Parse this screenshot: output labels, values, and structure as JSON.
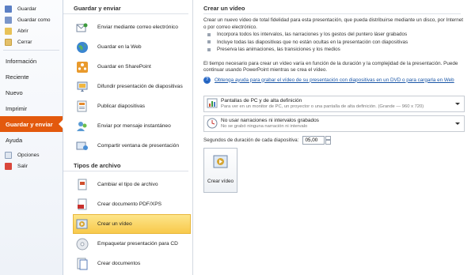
{
  "nav": {
    "top_items": [
      {
        "label": "Guardar",
        "icon": "save-icon"
      },
      {
        "label": "Guardar como",
        "icon": "save-as-icon"
      },
      {
        "label": "Abrir",
        "icon": "open-folder-icon"
      },
      {
        "label": "Cerrar",
        "icon": "close-file-icon"
      }
    ],
    "main_items": [
      {
        "label": "Información"
      },
      {
        "label": "Reciente"
      },
      {
        "label": "Nuevo"
      },
      {
        "label": "Imprimir"
      },
      {
        "label": "Guardar y enviar",
        "active": true
      },
      {
        "label": "Ayuda"
      }
    ],
    "bottom_items": [
      {
        "label": "Opciones",
        "icon": "options-icon"
      },
      {
        "label": "Salir",
        "icon": "exit-icon"
      }
    ]
  },
  "middle": {
    "section1_title": "Guardar y enviar",
    "section1_items": [
      {
        "label": "Enviar mediante correo electrónico",
        "icon": "email-icon"
      },
      {
        "label": "Guardar en la Web",
        "icon": "web-globe-icon"
      },
      {
        "label": "Guardar en SharePoint",
        "icon": "sharepoint-icon"
      },
      {
        "label": "Difundir presentación de diapositivas",
        "icon": "broadcast-icon"
      },
      {
        "label": "Publicar diapositivas",
        "icon": "publish-slides-icon"
      },
      {
        "label": "Enviar por mensaje instantáneo",
        "icon": "instant-message-icon"
      },
      {
        "label": "Compartir ventana de presentación",
        "icon": "share-window-icon"
      }
    ],
    "section2_title": "Tipos de archivo",
    "section2_items": [
      {
        "label": "Cambiar el tipo de archivo",
        "icon": "change-file-type-icon"
      },
      {
        "label": "Crear documento PDF/XPS",
        "icon": "pdf-document-icon"
      },
      {
        "label": "Crear un vídeo",
        "icon": "video-icon",
        "selected": true
      },
      {
        "label": "Empaquetar presentación para CD",
        "icon": "cd-package-icon"
      },
      {
        "label": "Crear documentos",
        "icon": "handouts-icon"
      }
    ]
  },
  "right": {
    "title": "Crear un vídeo",
    "description": "Crear un nuevo vídeo de total fidelidad para esta presentación, que pueda distribuirse mediante un disco, por Internet o por correo electrónico.",
    "bullets": [
      "Incorpora todos los intervalos, las narraciones y los gestos del puntero láser grabados",
      "Incluye todas las diapositivas que no están ocultas en la presentación con diapositivas",
      "Preserva las animaciones, las transiciones y los medios"
    ],
    "note": "El tiempo necesario para crear un vídeo varía en función de la duración y la complejidad de la presentación. Puede continuar usando PowerPoint mientras se crea el vídeo.",
    "help_link": "Obtenga ayuda para grabar el vídeo de su presentación con diapositivas en un DVD o para cargarla en Web",
    "dropdown1": {
      "title": "Pantallas de PC y de alta definición",
      "subtitle": "Para ver en un monitor de PC, un proyector o una pantalla de alta definición. (Grande — 960 x 720)"
    },
    "dropdown2": {
      "title": "No usar narraciones ni intervalos grabados",
      "subtitle": "No se grabó ninguna narración ni intervalo"
    },
    "seconds_label": "Segundos de duración de cada diapositiva:",
    "seconds_value": "05,00",
    "create_button": "Crear vídeo"
  },
  "colors": {
    "accent_active": "#e3590d",
    "selected_bg": "#f8c94b",
    "link": "#1a56a7"
  }
}
